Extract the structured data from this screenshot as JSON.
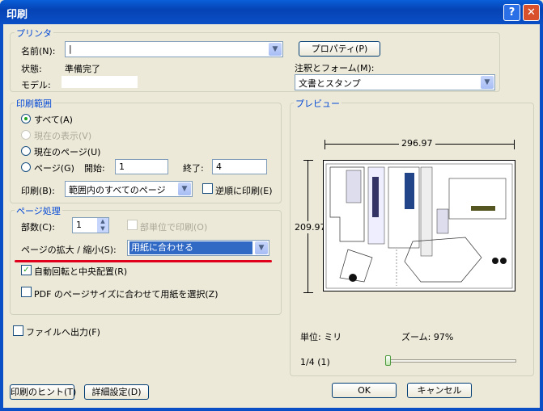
{
  "window": {
    "title": "印刷",
    "help": "?",
    "close": "✕"
  },
  "printer": {
    "group_title": "プリンタ",
    "name_label": "名前(N):",
    "name_value": "|",
    "properties_button": "プロパティ(P)",
    "status_label": "状態:",
    "status_value": "準備完了",
    "model_label": "モデル:",
    "model_value": "",
    "comments_label": "注釈とフォーム(M):",
    "comments_value": "文書とスタンプ"
  },
  "range": {
    "group_title": "印刷範囲",
    "all": "すべて(A)",
    "current_view": "現在の表示(V)",
    "current_page": "現在のページ(U)",
    "pages": "ページ(G)",
    "start_label": "開始:",
    "start_value": "1",
    "end_label": "終了:",
    "end_value": "4",
    "print_label": "印刷(B):",
    "print_value": "範囲内のすべてのページ",
    "reverse": "逆順に印刷(E)"
  },
  "handling": {
    "group_title": "ページ処理",
    "copies_label": "部数(C):",
    "copies_value": "1",
    "collate": "部単位で印刷(O)",
    "scaling_label": "ページの拡大 / 縮小(S):",
    "scaling_value": "用紙に合わせる",
    "auto_rotate": "自動回転と中央配置(R)",
    "pdf_size": "PDF のページサイズに合わせて用紙を選択(Z)"
  },
  "print_to_file": "ファイルへ出力(F)",
  "preview": {
    "group_title": "プレビュー",
    "width": "296.97",
    "height": "209.97",
    "units": "単位: ミリ",
    "zoom": "ズーム: 97%",
    "page_indicator": "1/4 (1)",
    "page_fraction": 0.0
  },
  "buttons": {
    "tips": "印刷のヒント(T)",
    "advanced": "詳細設定(D)",
    "ok": "OK",
    "cancel": "キャンセル"
  },
  "colors": {
    "title_bar": "#0b4fc6",
    "group_title": "#0046d5",
    "highlight": "#316ac5",
    "annotation": "#e0001b"
  }
}
